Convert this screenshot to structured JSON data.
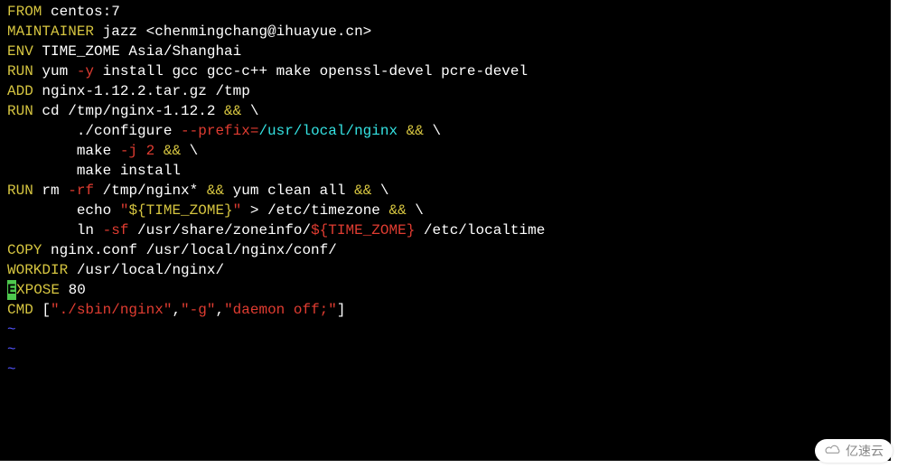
{
  "lines": [
    {
      "parts": [
        {
          "t": "FROM",
          "c": "kw"
        },
        {
          "t": " centos:7",
          "c": ""
        }
      ]
    },
    {
      "parts": [
        {
          "t": "MAINTAINER",
          "c": "kw"
        },
        {
          "t": " jazz <chenmingchang@ihuayue.cn>",
          "c": ""
        }
      ]
    },
    {
      "parts": [
        {
          "t": "ENV",
          "c": "kw"
        },
        {
          "t": " TIME_ZOME Asia/Shanghai",
          "c": ""
        }
      ]
    },
    {
      "parts": [
        {
          "t": "",
          "c": ""
        }
      ]
    },
    {
      "parts": [
        {
          "t": "RUN",
          "c": "kw"
        },
        {
          "t": " yum ",
          "c": ""
        },
        {
          "t": "-y",
          "c": "red"
        },
        {
          "t": " install gcc gcc-c++ make openssl-devel pcre-devel",
          "c": ""
        }
      ]
    },
    {
      "parts": [
        {
          "t": "ADD",
          "c": "kw"
        },
        {
          "t": " nginx-1.12.2.tar.gz /tmp",
          "c": ""
        }
      ]
    },
    {
      "parts": [
        {
          "t": "",
          "c": ""
        }
      ]
    },
    {
      "parts": [
        {
          "t": "RUN",
          "c": "kw"
        },
        {
          "t": " cd /tmp/nginx-1.12.2 ",
          "c": ""
        },
        {
          "t": "&&",
          "c": "kw"
        },
        {
          "t": " \\",
          "c": ""
        }
      ]
    },
    {
      "parts": [
        {
          "t": "        ./configure ",
          "c": ""
        },
        {
          "t": "--prefix=",
          "c": "red"
        },
        {
          "t": "/usr/local/nginx ",
          "c": "cyan"
        },
        {
          "t": "&&",
          "c": "kw"
        },
        {
          "t": " \\",
          "c": ""
        }
      ]
    },
    {
      "parts": [
        {
          "t": "        make ",
          "c": ""
        },
        {
          "t": "-j",
          "c": "red"
        },
        {
          "t": " 2",
          "c": "red"
        },
        {
          "t": " ",
          "c": ""
        },
        {
          "t": "&&",
          "c": "kw"
        },
        {
          "t": " \\",
          "c": ""
        }
      ]
    },
    {
      "parts": [
        {
          "t": "        make install",
          "c": ""
        }
      ]
    },
    {
      "parts": [
        {
          "t": "",
          "c": ""
        }
      ]
    },
    {
      "parts": [
        {
          "t": "RUN",
          "c": "kw"
        },
        {
          "t": " rm ",
          "c": ""
        },
        {
          "t": "-rf",
          "c": "red"
        },
        {
          "t": " /tmp/nginx* ",
          "c": ""
        },
        {
          "t": "&&",
          "c": "kw"
        },
        {
          "t": " yum clean all ",
          "c": ""
        },
        {
          "t": "&&",
          "c": "kw"
        },
        {
          "t": " \\",
          "c": ""
        }
      ]
    },
    {
      "parts": [
        {
          "t": "        echo ",
          "c": ""
        },
        {
          "t": "\"",
          "c": "red"
        },
        {
          "t": "${TIME_ZOME}",
          "c": "kw"
        },
        {
          "t": "\"",
          "c": "red"
        },
        {
          "t": " > /etc/timezone ",
          "c": ""
        },
        {
          "t": "&&",
          "c": "kw"
        },
        {
          "t": " \\",
          "c": ""
        }
      ]
    },
    {
      "parts": [
        {
          "t": "        ln ",
          "c": ""
        },
        {
          "t": "-sf",
          "c": "red"
        },
        {
          "t": " /usr/share/zoneinfo/",
          "c": ""
        },
        {
          "t": "${TIME_ZOME}",
          "c": "red"
        },
        {
          "t": " /etc/localtime",
          "c": ""
        }
      ]
    },
    {
      "parts": [
        {
          "t": "",
          "c": ""
        }
      ]
    },
    {
      "parts": [
        {
          "t": "COPY",
          "c": "kw"
        },
        {
          "t": " nginx.conf /usr/local/nginx/conf/",
          "c": ""
        }
      ]
    },
    {
      "parts": [
        {
          "t": "WORKDIR",
          "c": "kw"
        },
        {
          "t": " /usr/local/nginx/",
          "c": ""
        }
      ]
    },
    {
      "cursor": "E",
      "parts": [
        {
          "t": "XPOSE",
          "c": "kw"
        },
        {
          "t": " 80",
          "c": ""
        }
      ]
    },
    {
      "parts": [
        {
          "t": "CMD",
          "c": "kw"
        },
        {
          "t": " [",
          "c": ""
        },
        {
          "t": "\"./sbin/nginx\"",
          "c": "red"
        },
        {
          "t": ",",
          "c": ""
        },
        {
          "t": "\"-g\"",
          "c": "red"
        },
        {
          "t": ",",
          "c": ""
        },
        {
          "t": "\"daemon off;\"",
          "c": "red"
        },
        {
          "t": "]",
          "c": ""
        }
      ]
    }
  ],
  "tildes": [
    "~",
    "~",
    "~"
  ],
  "watermark": "亿速云"
}
